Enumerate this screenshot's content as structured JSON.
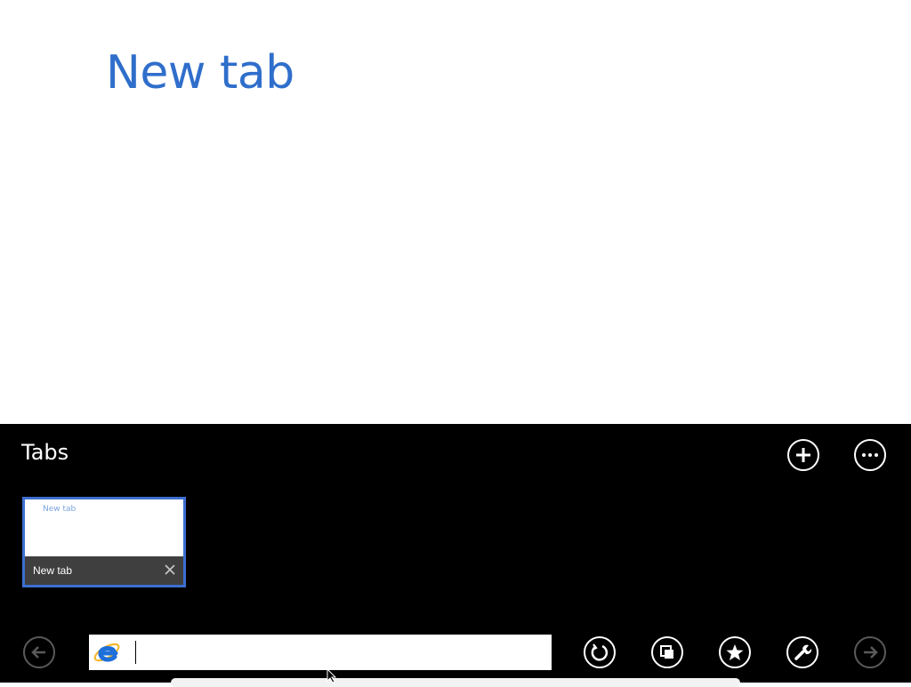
{
  "page": {
    "title": "New tab"
  },
  "appbar": {
    "tabs_heading": "Tabs",
    "tabs": [
      {
        "label": "New tab",
        "preview_title": "New tab",
        "selected": true
      }
    ]
  },
  "navbar": {
    "address": {
      "value": "",
      "placeholder": ""
    }
  },
  "icons": {
    "new_tab": "plus-icon",
    "tab_tools": "ellipsis-icon",
    "back": "back-arrow-icon",
    "refresh": "refresh-icon",
    "pin": "pin-to-start-icon",
    "favorites": "star-icon",
    "page_tools": "wrench-icon",
    "forward": "forward-arrow-icon",
    "browser_logo": "internet-explorer-logo"
  },
  "colors": {
    "accent": "#2f6ecb",
    "tab_border": "#3c6fd1",
    "appbar_bg": "#000000",
    "tab_footer_bg": "#3f3f3f"
  }
}
